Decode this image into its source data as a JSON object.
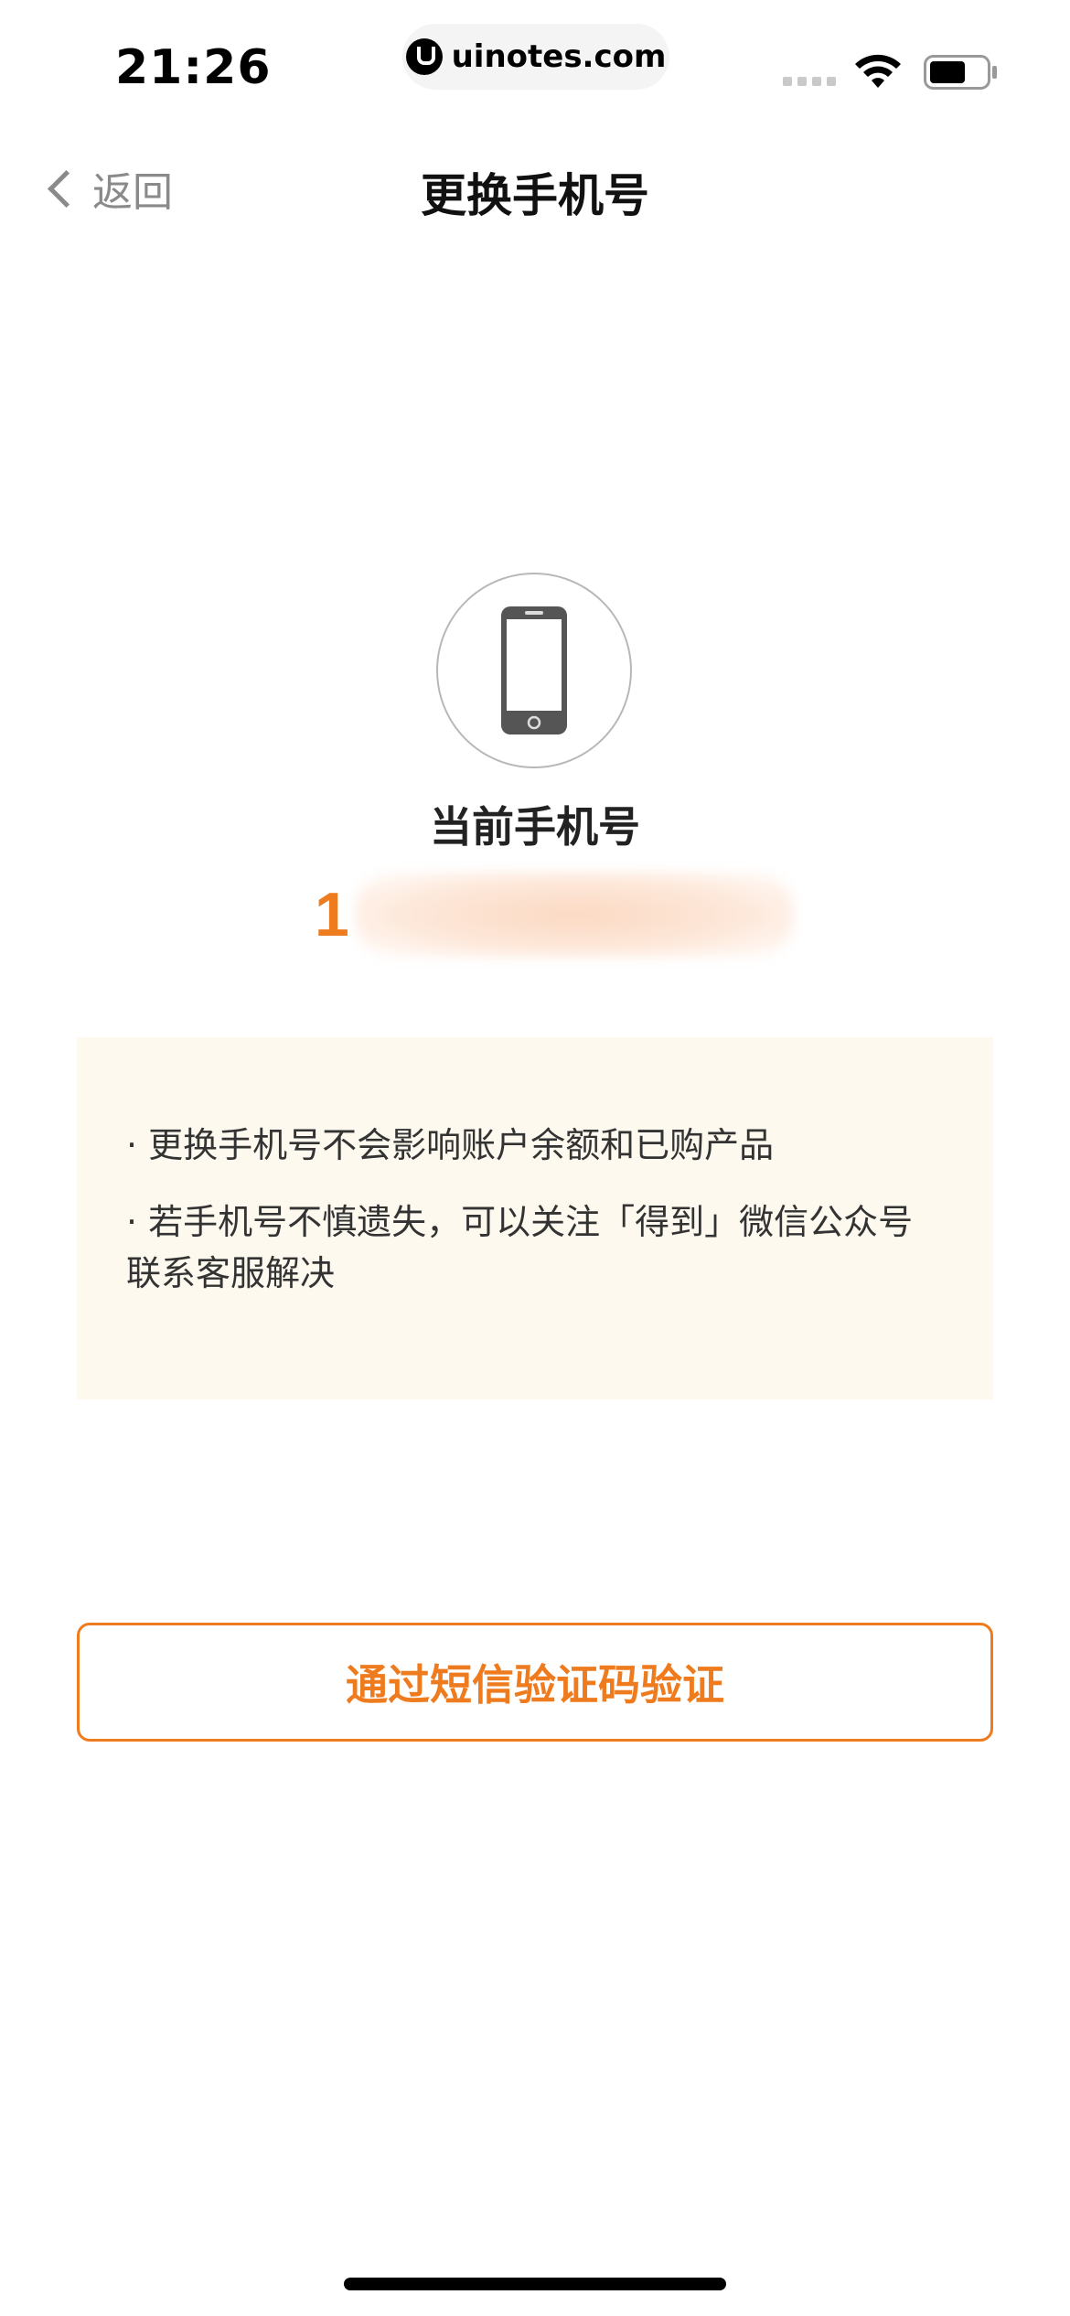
{
  "status_bar": {
    "time": "21:26",
    "watermark": "uinotes.com"
  },
  "nav": {
    "back_label": "返回",
    "title": "更换手机号"
  },
  "phone_section": {
    "label": "当前手机号",
    "number_first_digit": "1"
  },
  "tips": [
    "· 更换手机号不会影响账户余额和已购产品",
    "· 若手机号不慎遗失，可以关注「得到」微信公众号联系客服解决"
  ],
  "actions": {
    "sms_verify_label": "通过短信验证码验证"
  },
  "colors": {
    "accent": "#ef7b1f",
    "tips_background": "#fdf9ef"
  }
}
